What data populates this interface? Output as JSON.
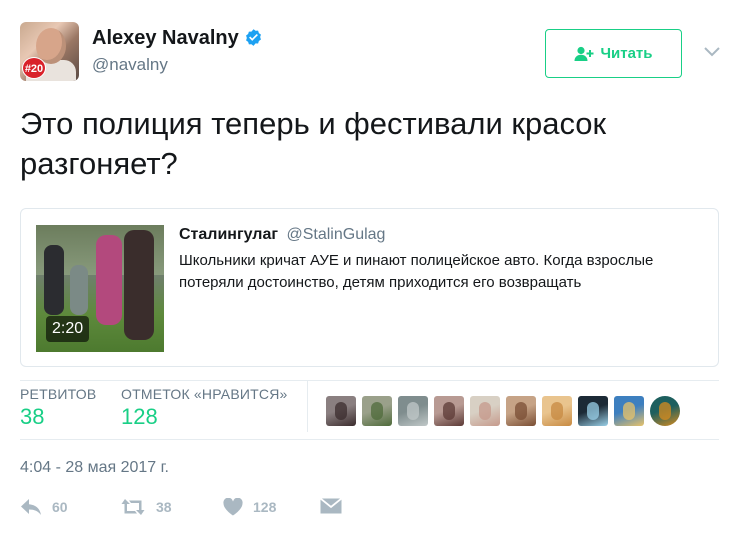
{
  "author": {
    "name": "Alexey Navalny",
    "handle": "@navalny",
    "avatar_badge": "#20",
    "verified_icon": "verified-badge-icon"
  },
  "follow_button": {
    "label": "Читать",
    "icon": "follow-user-icon"
  },
  "menu_icon": "chevron-down-icon",
  "tweet": {
    "text": "Это полиция теперь и фестивали красок разгоняет?"
  },
  "quoted": {
    "author_name": "Сталингулаг",
    "author_handle": "@StalinGulag",
    "text": "Школьники кричат АУЕ и пинают полицейское авто. Когда взрослые потеряли достоинство, детям приходится его возвращать",
    "video_duration": "2:20"
  },
  "stats": {
    "retweets_label": "РЕТВИТОВ",
    "retweets_value": "38",
    "likes_label": "ОТМЕТОК «НРАВИТСЯ»",
    "likes_value": "128"
  },
  "likers": [
    {
      "color": "#8a7f80",
      "accent": "#3b2c2d"
    },
    {
      "color": "#9aa08a",
      "accent": "#4f6b3b"
    },
    {
      "color": "#7f8d8e",
      "accent": "#c0c8c8"
    },
    {
      "color": "#b89a93",
      "accent": "#5c3a36"
    },
    {
      "color": "#d8d0c4",
      "accent": "#c69a8c"
    },
    {
      "color": "#c6a386",
      "accent": "#7a4e34"
    },
    {
      "color": "#e9c48e",
      "accent": "#c78a42"
    },
    {
      "color": "#1c2a36",
      "accent": "#9ad0e8"
    },
    {
      "color": "#3d7fbf",
      "accent": "#e8c36a"
    },
    {
      "color": "#1d5f5e",
      "accent": "#d68b1f"
    }
  ],
  "timestamp": "4:04 - 28 мая 2017 г.",
  "actions": {
    "reply_count": "60",
    "retweet_count": "38",
    "like_count": "128"
  },
  "colors": {
    "accent_green": "#19cf86",
    "muted": "#657786",
    "icon_grey": "#aab8c2",
    "border": "#e1e8ed"
  }
}
